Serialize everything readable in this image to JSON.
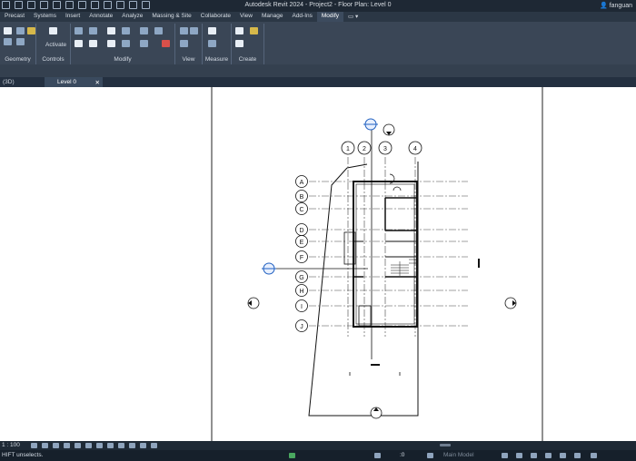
{
  "window": {
    "title": "Autodesk Revit 2024 - Project2 - Floor Plan: Level 0",
    "user": "fanguan"
  },
  "ribbon_tabs": [
    "Precast",
    "Systems",
    "Insert",
    "Annotate",
    "Analyze",
    "Massing & Site",
    "Collaborate",
    "View",
    "Manage",
    "Add-Ins",
    "Modify"
  ],
  "active_tab": "Modify",
  "ribbon_groups": {
    "geometry": "Geometry",
    "controls": "Controls",
    "activate": "Activate",
    "modify": "Modify",
    "view": "View",
    "measure": "Measure",
    "create": "Create"
  },
  "view_tabs": {
    "prev": "(3D)",
    "active": "Level 0",
    "close": "✕"
  },
  "grid_labels": {
    "columns": [
      "1",
      "2",
      "3",
      "4"
    ],
    "rows": [
      "A",
      "B",
      "C",
      "D",
      "E",
      "F",
      "G",
      "H",
      "I",
      "J"
    ]
  },
  "status": {
    "scale": "1 : 100",
    "message": "HIFT unselects.",
    "selection_count": ":0",
    "model": "Main Model"
  },
  "colors": {
    "titlebar": "#1e2834",
    "ribbon": "#3a4656",
    "accent_blue": "#2060c0"
  }
}
